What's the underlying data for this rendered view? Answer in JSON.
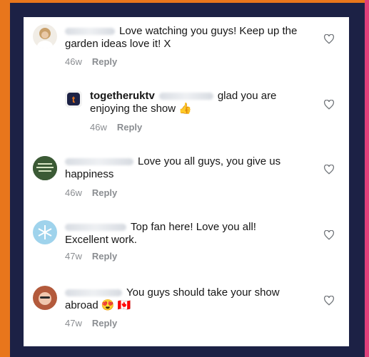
{
  "comments": [
    {
      "name": "",
      "text": "Love watching you guys! Keep up the garden ideas love it! X",
      "time": "46w",
      "reply": "Reply"
    },
    {
      "name": "togetheruktv",
      "text": "glad you are enjoying the show 👍",
      "time": "46w",
      "reply": "Reply"
    },
    {
      "name": "",
      "text": "Love you all guys, you give us happiness",
      "time": "46w",
      "reply": "Reply"
    },
    {
      "name": "",
      "text": "Top fan here! Love you all! Excellent work.",
      "time": "47w",
      "reply": "Reply"
    },
    {
      "name": "",
      "text": "You guys should take your show abroad 😍 🇨🇦",
      "time": "47w",
      "reply": "Reply"
    }
  ],
  "icons": {
    "like": "heart-icon",
    "brand": "togetheruktv-logo"
  },
  "colors": {
    "orange": "#e8761c",
    "navy": "#1c2145",
    "pink": "#e0407a",
    "meta": "#8a8d91"
  }
}
